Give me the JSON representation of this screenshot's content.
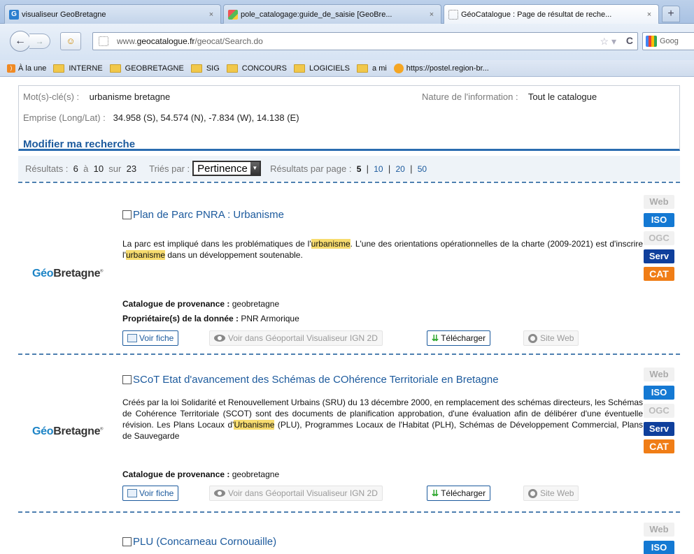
{
  "browser": {
    "tabs": [
      {
        "title": "visualiseur GeoBretagne",
        "close": "×"
      },
      {
        "title": "pole_catalogage:guide_de_saisie [GeoBre...",
        "close": "×"
      },
      {
        "title": "GéoCatalogue : Page de résultat de reche...",
        "close": "×"
      }
    ],
    "new_tab": "+",
    "back": "←",
    "forward": "→",
    "url_plain": "www.",
    "url_domain": "geocatalogue.fr",
    "url_path": "/geocat/Search.do",
    "search_text": "Goog",
    "bookmarks": [
      {
        "label": "À la une",
        "icon": "rss-icon"
      },
      {
        "label": "INTERNE",
        "icon": "folder-icon"
      },
      {
        "label": "GEOBRETAGNE",
        "icon": "folder-icon"
      },
      {
        "label": "SIG",
        "icon": "folder-icon"
      },
      {
        "label": "CONCOURS",
        "icon": "folder-icon"
      },
      {
        "label": "LOGICIELS",
        "icon": "folder-icon"
      },
      {
        "label": "a mi",
        "icon": "folder-icon"
      },
      {
        "label": "https://postel.region-br...",
        "icon": "site-icon"
      }
    ]
  },
  "criteria": {
    "keywords_label": "Mot(s)-clé(s) :",
    "keywords_value": "urbanisme bretagne",
    "nature_label": "Nature de l'information :",
    "nature_value": "Tout le catalogue",
    "extent_label": "Emprise (Long/Lat) :",
    "extent_value": "34.958 (S), 54.574 (N), -7.834 (W), 14.138 (E)",
    "modify_link": "Modifier ma recherche"
  },
  "results_bar": {
    "results_label": "Résultats :",
    "from": "6",
    "to_label": "à",
    "to": "10",
    "of_label": "sur",
    "total": "23",
    "sort_label": "Triés par :",
    "sort_value": "Pertinence",
    "per_page_label": "Résultats par page :",
    "per_page_options": [
      "5",
      "10",
      "20",
      "50"
    ],
    "per_page_current": "5",
    "sep": "|"
  },
  "logo": {
    "geo": "Géo",
    "rest": "Bretagne",
    "mark": "®"
  },
  "results": [
    {
      "title": "Plan de Parc PNRA : Urbanisme",
      "desc_parts": [
        {
          "t": "La parc est impliqué dans les problématiques de l'"
        },
        {
          "t": "urbanisme",
          "hl": true
        },
        {
          "t": ". L'une des orientations opérationnelles de la charte (2009-2021) est d'inscrire l'"
        },
        {
          "t": "urbanisme",
          "hl": true
        },
        {
          "t": " dans un développement soutenable."
        }
      ],
      "catalog_label": "Catalogue de provenance :",
      "catalog_value": "geobretagne",
      "owner_label": "Propriétaire(s) de la donnée :",
      "owner_value": "PNR Armorique"
    },
    {
      "title": "SCoT Etat d'avancement des Schémas de COhérence Territoriale en Bretagne",
      "desc_parts": [
        {
          "t": "Créés par la loi Solidarité et Renouvellement Urbains (SRU) du 13 décembre 2000, en remplacement des schémas directeurs, les Schémas de Cohérence Territoriale (SCOT) sont des documents de planification approbation, d'une évaluation afin de délibérer d'une éventuelle révision. Les Plans Locaux d'"
        },
        {
          "t": "Urbanisme",
          "hl": true
        },
        {
          "t": " (PLU), Programmes Locaux de l'Habitat (PLH), Schémas de Développement Commercial, Plans de Sauvegarde"
        }
      ],
      "catalog_label": "Catalogue de provenance :",
      "catalog_value": "geobretagne"
    },
    {
      "title": "PLU (Concarneau Cornouaille)"
    }
  ],
  "actions": {
    "view_record": "Voir fiche",
    "view_portal": "Voir dans Géoportail Visualiseur IGN 2D",
    "download": "Télécharger",
    "website": "Site Web"
  },
  "badges": {
    "web": "Web",
    "iso": "ISO",
    "ogc": "OGC",
    "serv": "Serv",
    "cat": "CAT"
  }
}
